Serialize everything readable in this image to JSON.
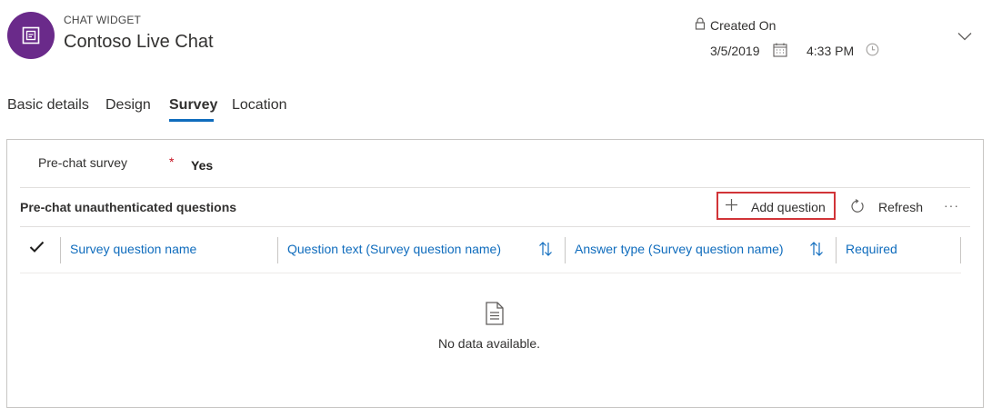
{
  "header": {
    "entity_type": "CHAT WIDGET",
    "record_name": "Contoso Live Chat",
    "created_label": "Created On",
    "created_date": "3/5/2019",
    "created_time": "4:33 PM"
  },
  "tabs": [
    {
      "label": "Basic details",
      "active": false
    },
    {
      "label": "Design",
      "active": false
    },
    {
      "label": "Survey",
      "active": true
    },
    {
      "label": "Location",
      "active": false
    }
  ],
  "form": {
    "field_label": "Pre-chat survey",
    "required_marker": "*",
    "field_value": "Yes"
  },
  "subgrid": {
    "title": "Pre-chat unauthenticated questions",
    "add_label": "Add question",
    "refresh_label": "Refresh",
    "more_label": "···",
    "columns": [
      "Survey question name",
      "Question text (Survey question name)",
      "Answer type (Survey question name)",
      "Required"
    ],
    "empty_message": "No data available."
  },
  "colors": {
    "accent": "#0f6cbd",
    "avatar": "#6a2a8a",
    "highlight_border": "#d13438",
    "required": "#c50f1f"
  },
  "icons": [
    "chat-widget-icon",
    "lock-icon",
    "calendar-icon",
    "clock-icon",
    "chevron-down-icon",
    "plus-icon",
    "refresh-icon",
    "more-icon",
    "checkmark-icon",
    "sort-icon",
    "document-icon"
  ]
}
